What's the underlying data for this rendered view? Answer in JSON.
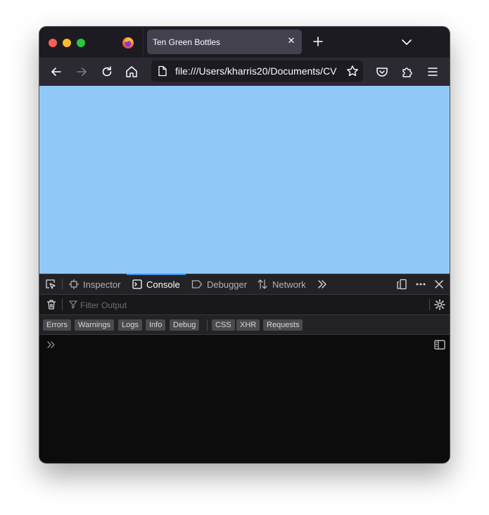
{
  "browser": {
    "tab": {
      "title": "Ten Green Bottles"
    },
    "url": "file:///Users/kharris20/Documents/CV"
  },
  "devtools": {
    "tabs": [
      "Inspector",
      "Console",
      "Debugger",
      "Network"
    ],
    "selected_tab": "Console",
    "filter_placeholder": "Filter Output",
    "log_filters": [
      "Errors",
      "Warnings",
      "Logs",
      "Info",
      "Debug"
    ],
    "request_filters": [
      "CSS",
      "XHR",
      "Requests"
    ]
  },
  "colors": {
    "page_background": "#90c8f8",
    "accent": "#3a8ee6"
  }
}
